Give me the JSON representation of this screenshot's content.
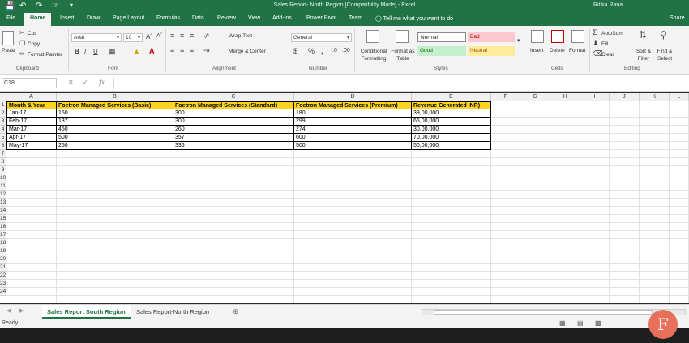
{
  "window": {
    "title": "Sales Report- North Region  [Compatibility Mode]  -  Excel",
    "user": "Ritika Rana"
  },
  "ribbon_tabs": [
    "File",
    "Home",
    "Insert",
    "Draw",
    "Page Layout",
    "Formulas",
    "Data",
    "Review",
    "View",
    "Add-ins",
    "Power Pivot",
    "Team"
  ],
  "tell_me": "Tell me what you want to do",
  "share": "Share",
  "clipboard": {
    "paste": "Paste",
    "cut": "Cut",
    "copy": "Copy",
    "painter": "Format Painter",
    "label": "Clipboard"
  },
  "font": {
    "name": "Arial",
    "size": "10",
    "label": "Font"
  },
  "alignment": {
    "wrap": "Wrap Text",
    "merge": "Merge & Center",
    "label": "Alignment"
  },
  "number": {
    "format": "General",
    "label": "Number"
  },
  "styles": {
    "conditional": "Conditional Formatting",
    "format_table": "Format as Table",
    "normal": "Normal",
    "bad": "Bad",
    "good": "Good",
    "neutral": "Neutral",
    "label": "Styles"
  },
  "cells": {
    "insert": "Insert",
    "delete": "Delete",
    "format": "Format",
    "label": "Cells"
  },
  "editing": {
    "autosum": "AutoSum",
    "fill": "Fill",
    "clear": "Clear",
    "sort": "Sort & Filter",
    "find": "Find & Select",
    "label": "Editing"
  },
  "namebox": "C18",
  "columns": [
    "A",
    "B",
    "C",
    "D",
    "E",
    "F",
    "G",
    "H",
    "I",
    "J",
    "K",
    "L"
  ],
  "table": {
    "headers": [
      "Month & Year",
      "Foetron Managed Services (Basic)",
      "Foetron Managed Services (Standard)",
      "Foetron Managed Services (Premium)",
      "Revenue Generated INR)"
    ],
    "rows": [
      [
        "Jan-17",
        "150",
        "300",
        "180",
        "39,00,000"
      ],
      [
        "Feb-17",
        "137",
        "300",
        "299",
        "65,00,000"
      ],
      [
        "Mar-17",
        "450",
        "260",
        "274",
        "30,00,000"
      ],
      [
        "Apr-17",
        "500",
        "357",
        "600",
        "70,00,000"
      ],
      [
        "May-17",
        "250",
        "336",
        "500",
        "50,00,000"
      ]
    ]
  },
  "sheets": [
    "Sales Report South Region",
    "Sales Report-North Region"
  ],
  "status": "Ready",
  "logo_letter": "F",
  "colors": {
    "excel_green": "#217346",
    "header_fill": "#ffd421"
  }
}
